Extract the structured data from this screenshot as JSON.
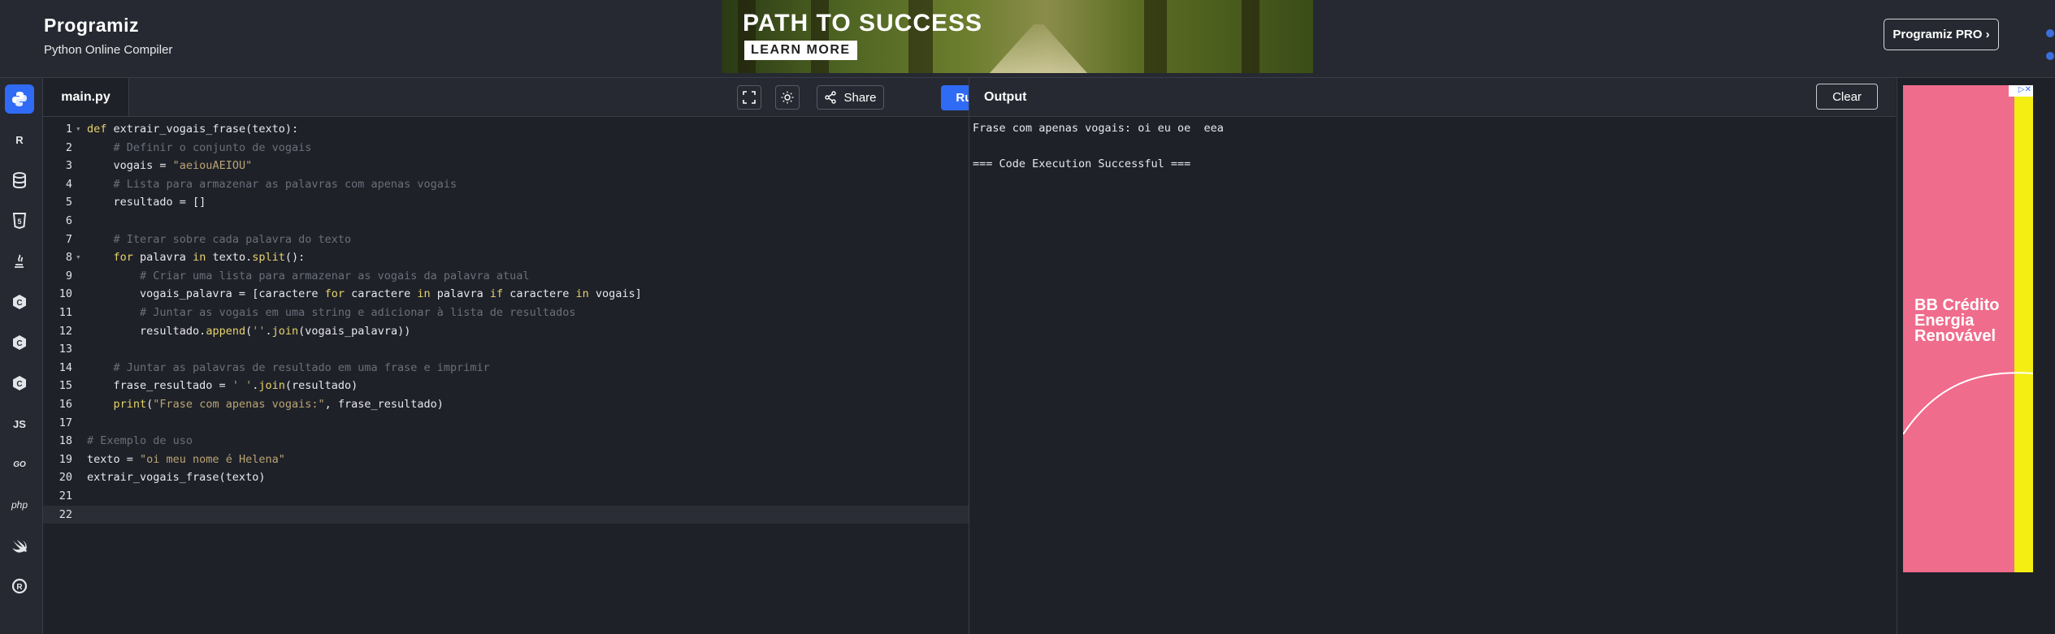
{
  "header": {
    "logo_text": "Programiz",
    "subtitle": "Python Online Compiler",
    "ad_title": "PATH TO SUCCESS",
    "ad_cta": "LEARN MORE",
    "pro_button": "Programiz PRO ›"
  },
  "sidebar": {
    "items": [
      {
        "icon": "python-icon",
        "label": ""
      },
      {
        "icon": "r-lang-icon",
        "label": "R"
      },
      {
        "icon": "database-icon",
        "label": ""
      },
      {
        "icon": "html5-icon",
        "label": "5"
      },
      {
        "icon": "java-icon",
        "label": ""
      },
      {
        "icon": "c-lang-icon",
        "label": "C"
      },
      {
        "icon": "cpp-icon",
        "label": "C"
      },
      {
        "icon": "csharp-icon",
        "label": "C"
      },
      {
        "icon": "javascript-icon",
        "label": "JS"
      },
      {
        "icon": "go-icon",
        "label": "GO"
      },
      {
        "icon": "php-icon",
        "label": "php"
      },
      {
        "icon": "swift-icon",
        "label": ""
      },
      {
        "icon": "rust-icon",
        "label": "R"
      }
    ]
  },
  "editor": {
    "tab_label": "main.py",
    "share_label": "Share",
    "run_label": "Run",
    "current_line": 22,
    "lines": [
      "def extrair_vogais_frase(texto):",
      "    # Definir o conjunto de vogais",
      "    vogais = \"aeiouAEIOU\"",
      "    # Lista para armazenar as palavras com apenas vogais",
      "    resultado = []",
      "",
      "    # Iterar sobre cada palavra do texto",
      "    for palavra in texto.split():",
      "        # Criar uma lista para armazenar as vogais da palavra atual",
      "        vogais_palavra = [caractere for caractere in palavra if caractere in vogais]",
      "        # Juntar as vogais em uma string e adicionar à lista de resultados",
      "        resultado.append(''.join(vogais_palavra))",
      "",
      "    # Juntar as palavras de resultado em uma frase e imprimir",
      "    frase_resultado = ' '.join(resultado)",
      "    print(\"Frase com apenas vogais:\", frase_resultado)",
      "",
      "# Exemplo de uso",
      "texto = \"oi meu nome é Helena\"",
      "extrair_vogais_frase(texto)",
      "",
      ""
    ]
  },
  "output": {
    "title": "Output",
    "clear_label": "Clear",
    "lines": [
      "Frase com apenas vogais: oi eu oe  eea",
      "",
      "=== Code Execution Successful ==="
    ]
  },
  "side_ad": {
    "text": "BB Crédito Energia Renovável"
  },
  "colors": {
    "accent": "#2f6bf5",
    "background": "#1f2129",
    "keyword": "#e6d36a",
    "comment": "#6b6f7a",
    "string": "#b9a472"
  }
}
